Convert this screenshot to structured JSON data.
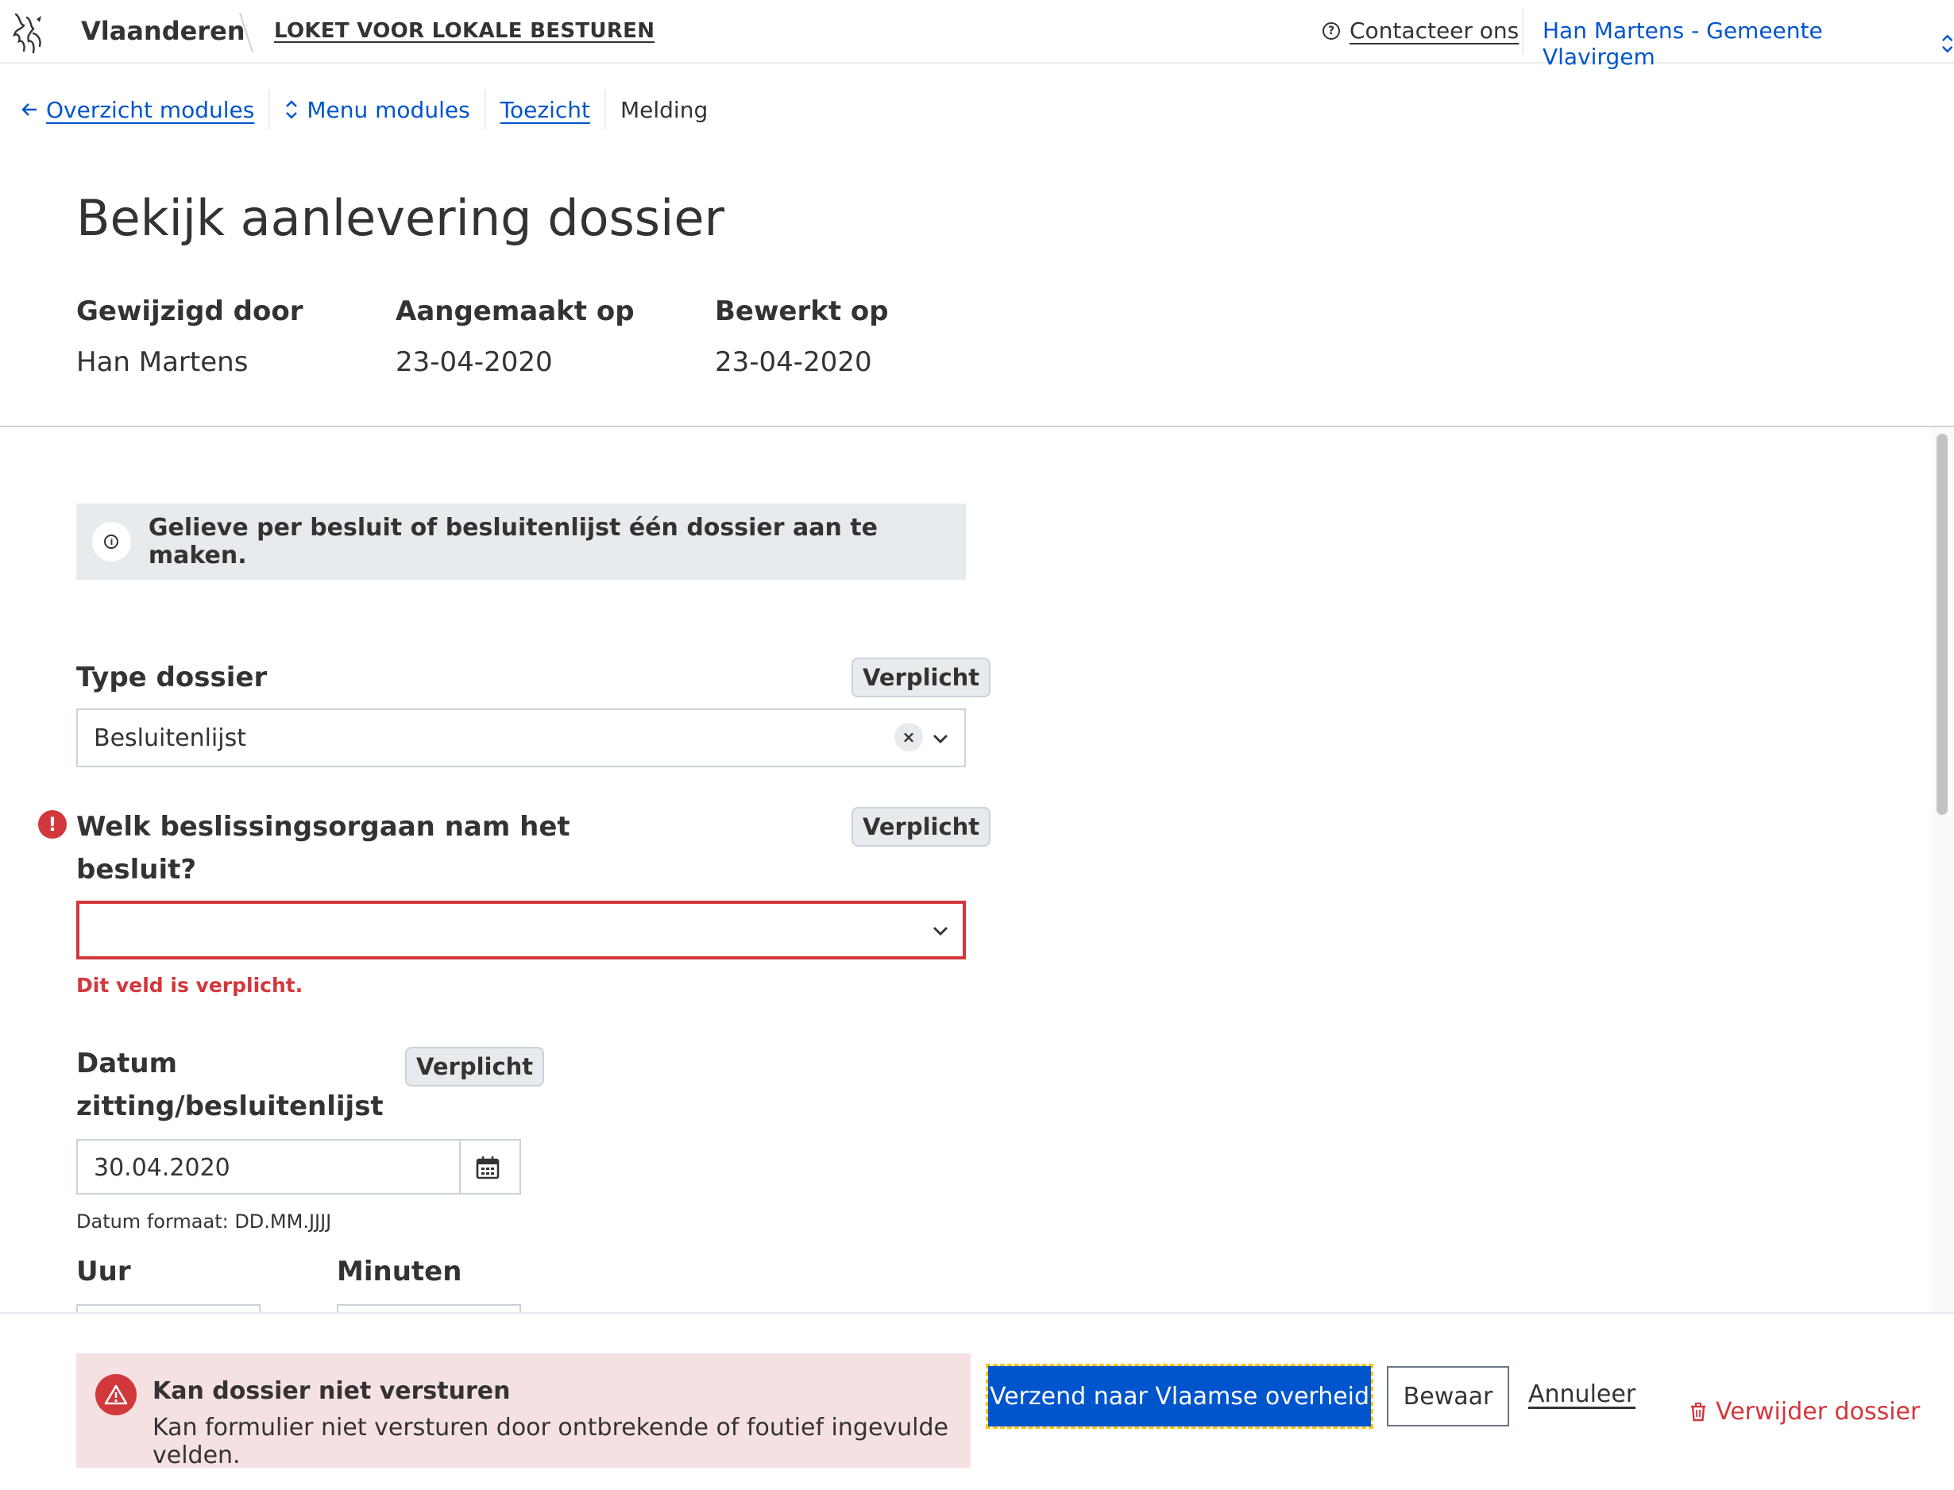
{
  "header": {
    "brand": "Vlaanderen",
    "app_title": "LOKET VOOR LOKALE BESTUREN",
    "contact_label": "Contacteer ons",
    "user_label": "Han Martens - Gemeente Vlavirgem"
  },
  "breadcrumb": {
    "items": [
      {
        "label": "Overzicht modules",
        "icon": "arrow-left-icon"
      },
      {
        "label": "Menu modules",
        "icon": "chevron-up-down-icon"
      },
      {
        "label": "Toezicht"
      },
      {
        "label": "Melding"
      }
    ]
  },
  "page": {
    "title": "Bekijk aanlevering dossier",
    "meta": [
      {
        "label": "Gewijzigd door",
        "value": "Han Martens"
      },
      {
        "label": "Aangemaakt op",
        "value": "23-04-2020"
      },
      {
        "label": "Bewerkt op",
        "value": "23-04-2020"
      }
    ]
  },
  "form": {
    "info_text": "Gelieve per besluit of besluitenlijst één dossier aan te maken.",
    "required_label": "Verplicht",
    "type_dossier": {
      "label": "Type dossier",
      "value": "Besluitenlijst"
    },
    "beslissingsorgaan": {
      "label_line1": "Welk beslissingsorgaan nam het",
      "label_line2": "besluit?",
      "value": "",
      "error": "Dit veld is verplicht."
    },
    "datum": {
      "label_line1": "Datum",
      "label_line2": "zitting/besluitenlijst",
      "value": "30.04.2020",
      "hint": "Datum formaat: DD.MM.JJJJ"
    },
    "uur_label": "Uur",
    "minuten_label": "Minuten"
  },
  "actions": {
    "alert_title": "Kan dossier niet versturen",
    "alert_text": "Kan formulier niet versturen door ontbrekende of foutief ingevulde velden.",
    "send_label": "Verzend naar Vlaamse overheid",
    "save_label": "Bewaar",
    "cancel_label": "Annuleer",
    "delete_label": "Verwijder dossier"
  },
  "colors": {
    "link": "#0055cc",
    "error": "#d2373c",
    "alert_bg": "#f6e1e2",
    "info_bg": "#e8ebee",
    "focus_outline": "#ffc515"
  }
}
